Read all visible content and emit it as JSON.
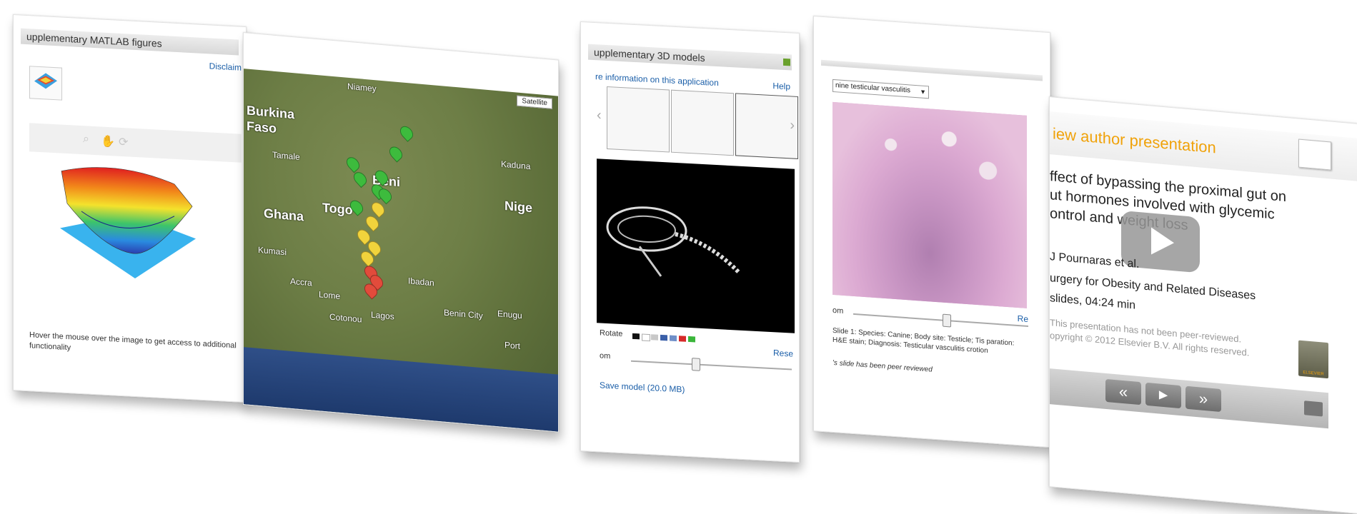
{
  "cards": {
    "matlab": {
      "title": "upplementary MATLAB figures",
      "disclaimer": "Disclaim",
      "instructions": "Hover the mouse over the image to get access to additional functionality"
    },
    "map": {
      "satellite_label": "Satellite",
      "labels": {
        "burkina": "Burkina",
        "faso": "Faso",
        "ghana": "Ghana",
        "togo": "Togo",
        "benin": "Beni",
        "nigeria": "Nige",
        "niamey": "Niamey",
        "cotonou": "Cotonou",
        "lagos": "Lagos",
        "ibadan": "Ibadan",
        "benin_city": "Benin City",
        "enugu": "Enugu",
        "kaduna": "Kaduna",
        "accra": "Accra",
        "lome": "Lome",
        "port": "Port",
        "kumasi": "Kumasi",
        "tamale": "Tamale"
      }
    },
    "models3d": {
      "title": "upplementary 3D models",
      "info_link": "re information on this application",
      "help_link": "Help",
      "rotate_label": "Rotate",
      "reset_label": "Rese",
      "zoom_label": "om",
      "save_link": "Save model (20.0 MB)"
    },
    "slide": {
      "dropdown_value": "nine testicular vasculitis",
      "zoom_label": "om",
      "reset_label": "Re",
      "caption": "Slide 1: Species: Canine; Body site: Testicle; Tis paration: H&E stain; Diagnosis: Testicular vasculitis crotion",
      "peer_note": "'s slide has been peer reviewed"
    },
    "presentation": {
      "header": "iew author presentation",
      "title_line1": "ffect of bypassing the proximal gut on",
      "title_line2": "ut hormones involved with glycemic",
      "title_line3": "ontrol and weight loss",
      "authors": "J Pournaras et al.",
      "journal": "urgery for Obesity and Related Diseases",
      "meta": "slides, 04:24 min",
      "note": "This presentation has not been peer-reviewed.",
      "copyright": "opyright © 2012 Elsevier B.V. All rights reserved.",
      "publisher": "ELSEVIER",
      "ctrl_prev": "«",
      "ctrl_play": "▶",
      "ctrl_next": "»"
    }
  },
  "colors": {
    "link": "#1a5ea8",
    "presentation_orange": "#f0a20a",
    "pin_green": "#3dbb3d",
    "pin_yellow": "#f1d33c",
    "pin_red": "#e24b3b"
  },
  "swatches": [
    "#111111",
    "#ffffff",
    "#c8c8c8",
    "#3a5fa8",
    "#6f8fc8",
    "#d62a2a",
    "#3bb63b"
  ]
}
